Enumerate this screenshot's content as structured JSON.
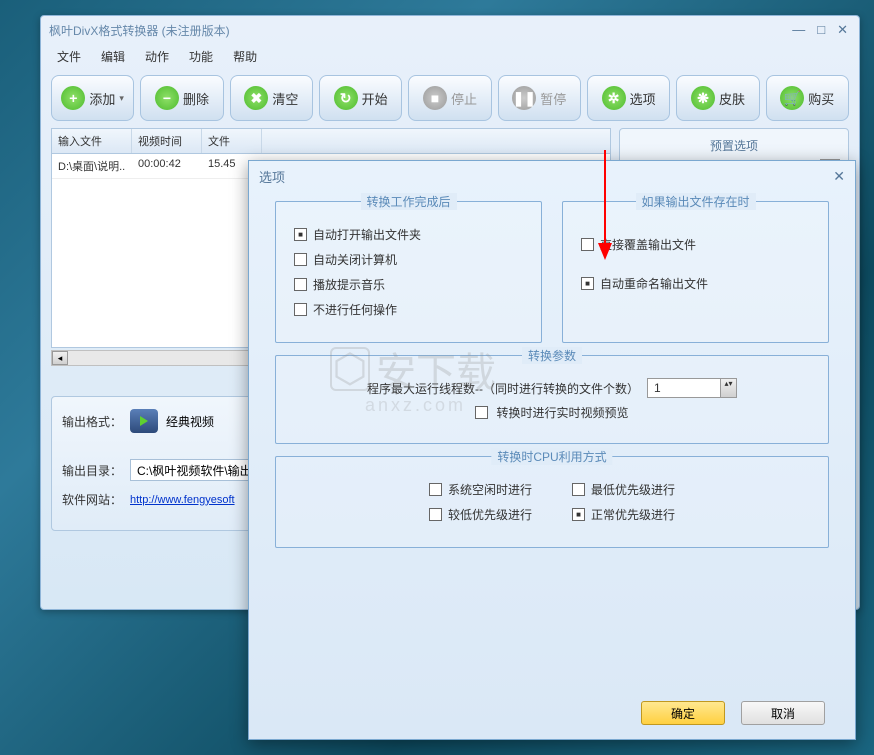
{
  "window": {
    "title": "枫叶DivX格式转换器   (未注册版本)"
  },
  "menu": {
    "file": "文件",
    "edit": "编辑",
    "action": "动作",
    "function": "功能",
    "help": "帮助"
  },
  "toolbar": {
    "add": "添加",
    "delete": "删除",
    "clear": "清空",
    "start": "开始",
    "stop": "停止",
    "pause": "暂停",
    "option": "选项",
    "skin": "皮肤",
    "buy": "购买"
  },
  "table": {
    "headers": {
      "input": "输入文件",
      "time": "视频时间",
      "size": "文件"
    },
    "rows": [
      {
        "input": "D:\\桌面\\说明..",
        "time": "00:00:42",
        "size": "15.45"
      }
    ]
  },
  "preset": {
    "title": "预置选项"
  },
  "form": {
    "output_format_label": "输出格式：",
    "output_format_value": "经典视频",
    "output_dir_label": "输出目录：",
    "output_dir_value": "C:\\枫叶视频软件\\输出",
    "website_label": "软件网站：",
    "website_url": "http://www.fengyesoft"
  },
  "dialog": {
    "title": "选项",
    "ok": "确定",
    "cancel": "取消",
    "group1_title": "转换工作完成后",
    "opt_open_folder": "自动打开输出文件夹",
    "opt_shutdown": "自动关闭计算机",
    "opt_play_sound": "播放提示音乐",
    "opt_do_nothing": "不进行任何操作",
    "group2_title": "如果输出文件存在时",
    "opt_overwrite": "直接覆盖输出文件",
    "opt_rename": "自动重命名输出文件",
    "group3_title": "转换参数",
    "threads_label": "程序最大运行线程数--（同时进行转换的文件个数）",
    "threads_value": "1",
    "realtime_preview": "转换时进行实时视频预览",
    "group4_title": "转换时CPU利用方式",
    "cpu_idle": "系统空闲时进行",
    "cpu_low": "较低优先级进行",
    "cpu_lowest": "最低优先级进行",
    "cpu_normal": "正常优先级进行"
  },
  "watermark": {
    "main": "安下载",
    "sub": "anxz.com"
  }
}
